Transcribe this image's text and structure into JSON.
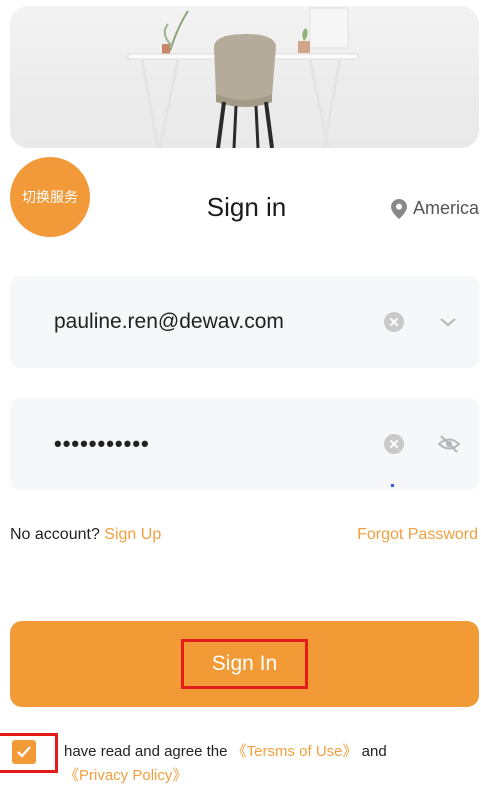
{
  "header": {
    "switch_service_label": "切换服务",
    "title": "Sign in",
    "region": "America"
  },
  "form": {
    "email_value": "pauline.ren@dewav.com",
    "password_value": "•••••••••••"
  },
  "links": {
    "no_account_text": "No account?",
    "sign_up": "Sign Up",
    "forgot_password": "Forgot Password"
  },
  "sign_in_button": "Sign In",
  "agreement": {
    "prefix": "have read and agree the",
    "terms": "《Tersms of Use》",
    "and": "and",
    "privacy": "《Privacy Policy》",
    "checked": true
  },
  "icons": {
    "region": "location-pin-icon",
    "clear": "clear-icon",
    "dropdown": "chevron-down-icon",
    "visibility": "eye-off-icon",
    "checkbox": "checkmark-icon"
  },
  "colors": {
    "accent": "#f29a35",
    "link": "#f0a040",
    "highlight": "#e51b1b"
  }
}
